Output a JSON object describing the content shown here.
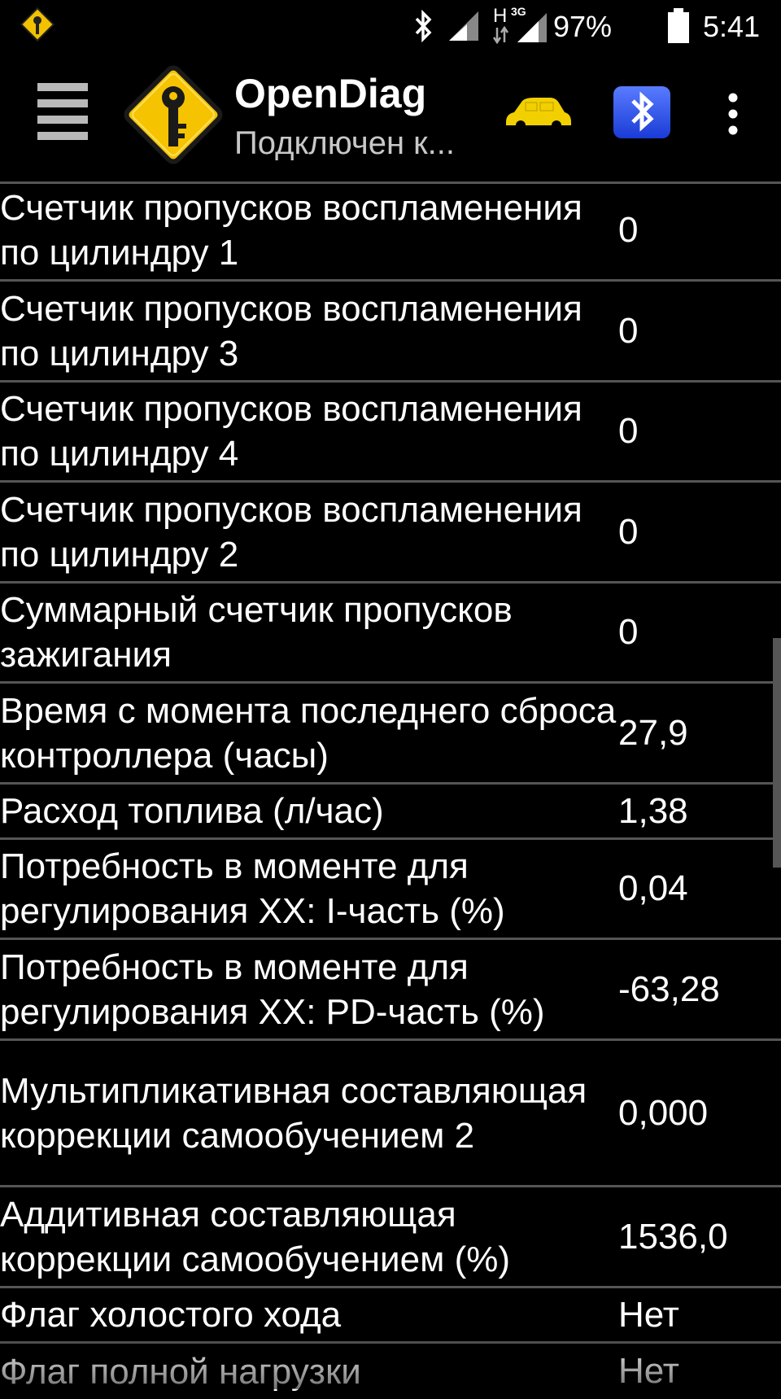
{
  "status_bar": {
    "network_label": "H",
    "network_sub": "3G",
    "battery_percent": "97%",
    "time": "5:41"
  },
  "action_bar": {
    "title": "OpenDiag",
    "subtitle": "Подключен к..."
  },
  "rows": [
    {
      "label": "Счетчик пропусков воспламенения по цилиндру 1",
      "value": "0"
    },
    {
      "label": "Счетчик пропусков воспламенения по цилиндру 3",
      "value": "0"
    },
    {
      "label": "Счетчик пропусков воспламенения по цилиндру 4",
      "value": "0"
    },
    {
      "label": "Счетчик пропусков воспламенения по цилиндру 2",
      "value": "0"
    },
    {
      "label": "Суммарный счетчик пропусков зажигания",
      "value": "0"
    },
    {
      "label": "Время с момента последнего сброса контроллера (часы)",
      "value": "27,9"
    },
    {
      "label": "Расход топлива (л/час)",
      "value": "1,38"
    },
    {
      "label": "Потребность в моменте для регулирования XX: I-часть (%)",
      "value": "0,04"
    },
    {
      "label": "Потребность в моменте для регулирования XX: PD-часть (%)",
      "value": "-63,28"
    },
    {
      "label": "Мультипликативная составляющая коррекции самообучением 2",
      "value": "0,000"
    },
    {
      "label": "Аддитивная составляющая коррекции самообучением (%)",
      "value": "1536,0"
    },
    {
      "label": "Флаг холостого хода",
      "value": "Нет"
    },
    {
      "label": "Флаг полной нагрузки",
      "value": "Нет"
    }
  ]
}
